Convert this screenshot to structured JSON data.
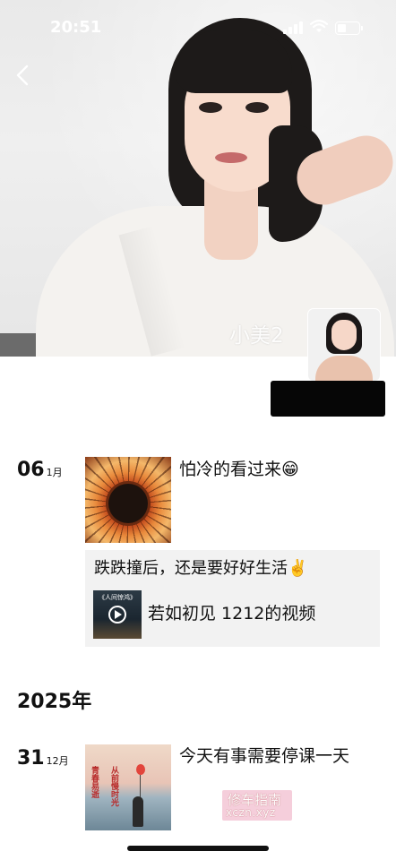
{
  "status_bar": {
    "time": "20:51"
  },
  "profile": {
    "name": "小美2"
  },
  "posts": [
    {
      "day": "06",
      "month": "1月",
      "text": "怕冷的看过来😁"
    },
    {
      "text": "跌跌撞后，还是要好好生活✌️",
      "share_caption": "《人间惊鸿》",
      "share_link": "若如初见 1212的视频"
    }
  ],
  "year_divider": "2025年",
  "post_dec": {
    "day": "31",
    "month": "12月",
    "text": "今天有事需要停课一天",
    "poem_left": "青春易逝",
    "poem_right": "从前慢时光"
  },
  "watermark": {
    "line1": "修车指南",
    "line2": "xczn.xyz"
  },
  "colors": {
    "redaction": "#060606",
    "card_bg": "#f2f2f2",
    "text": "#111111"
  },
  "icons": [
    "back-icon",
    "signal-icon",
    "wifi-icon",
    "battery-icon",
    "play-icon"
  ]
}
